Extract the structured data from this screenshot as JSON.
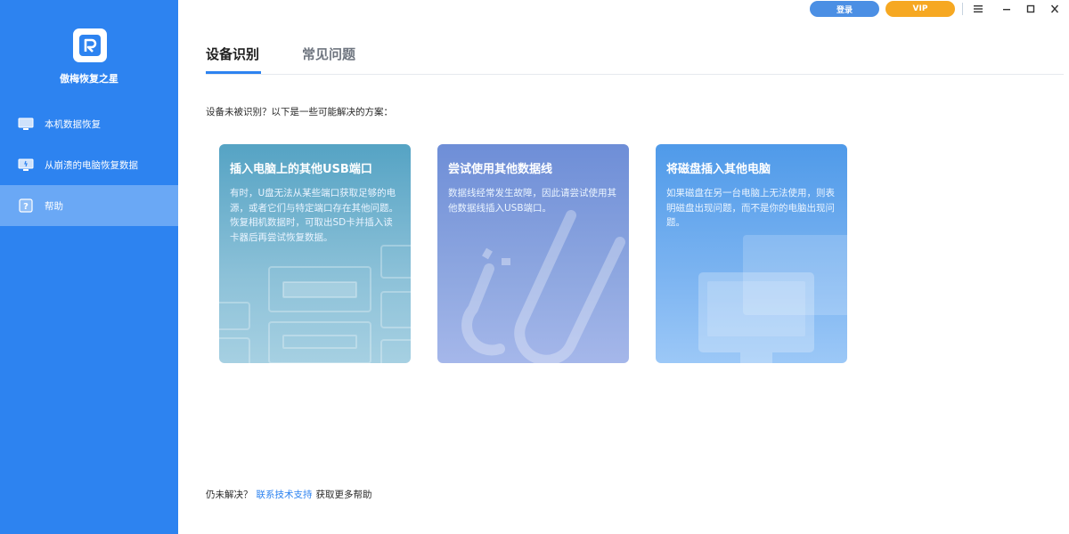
{
  "app": {
    "name": "傲梅恢复之星"
  },
  "sidebar": {
    "items": [
      {
        "label": "本机数据恢复",
        "icon": "monitor-icon"
      },
      {
        "label": "从崩溃的电脑恢复数据",
        "icon": "crashed-pc-icon"
      },
      {
        "label": "帮助",
        "icon": "help-icon"
      }
    ],
    "active_index": 2
  },
  "titlebar": {
    "login_label": "登录",
    "vip_label": "VIP",
    "icons": [
      "menu-icon",
      "minimize-icon",
      "maximize-icon",
      "close-icon"
    ]
  },
  "tabs": [
    {
      "label": "设备识别",
      "active": true
    },
    {
      "label": "常见问题",
      "active": false
    }
  ],
  "main": {
    "question": "设备未被识别？以下是一些可能解决的方案：",
    "cards": [
      {
        "title": "插入电脑上的其他USB端口",
        "desc": "有时，U盘无法从某些端口获取足够的电源，或者它们与特定端口存在其他问题。恢复相机数据时，可取出SD卡并插入读卡器后再尝试恢复数据。"
      },
      {
        "title": "尝试使用其他数据线",
        "desc": "数据线经常发生故障，因此请尝试使用其他数据线插入USB端口。"
      },
      {
        "title": "将磁盘插入其他电脑",
        "desc": "如果磁盘在另一台电脑上无法使用，则表明磁盘出现问题，而不是你的电脑出现问题。"
      }
    ]
  },
  "footer": {
    "prefix": "仍未解决？",
    "link": "联系技术支持",
    "suffix": "获取更多帮助"
  },
  "colors": {
    "sidebar": "#2d83f0",
    "active_nav": "#6aa8f5",
    "vip": "#f6a822",
    "login": "#4b8fe4"
  }
}
